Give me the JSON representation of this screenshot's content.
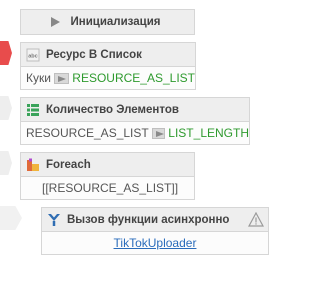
{
  "blocks": {
    "init": {
      "title": "Инициализация",
      "icon": "play-icon"
    },
    "resource": {
      "title": "Ресурс В Список",
      "icon": "resource-list-icon",
      "input": "Куки",
      "output": "RESOURCE_AS_LIST"
    },
    "count": {
      "title": "Количество Элементов",
      "icon": "list-count-icon",
      "input": "RESOURCE_AS_LIST",
      "output": "LIST_LENGTH"
    },
    "foreach": {
      "title": "Foreach",
      "icon": "foreach-icon",
      "value": "[[RESOURCE_AS_LIST]]"
    },
    "async_call": {
      "title": "Вызов функции асинхронно",
      "icon": "function-call-icon",
      "warning_icon": "warning-icon",
      "function": "TikTokUploader"
    }
  },
  "colors": {
    "active_marker": "#e84c4c",
    "variable_output": "#2e9a2e",
    "link": "#2a6cbb"
  }
}
